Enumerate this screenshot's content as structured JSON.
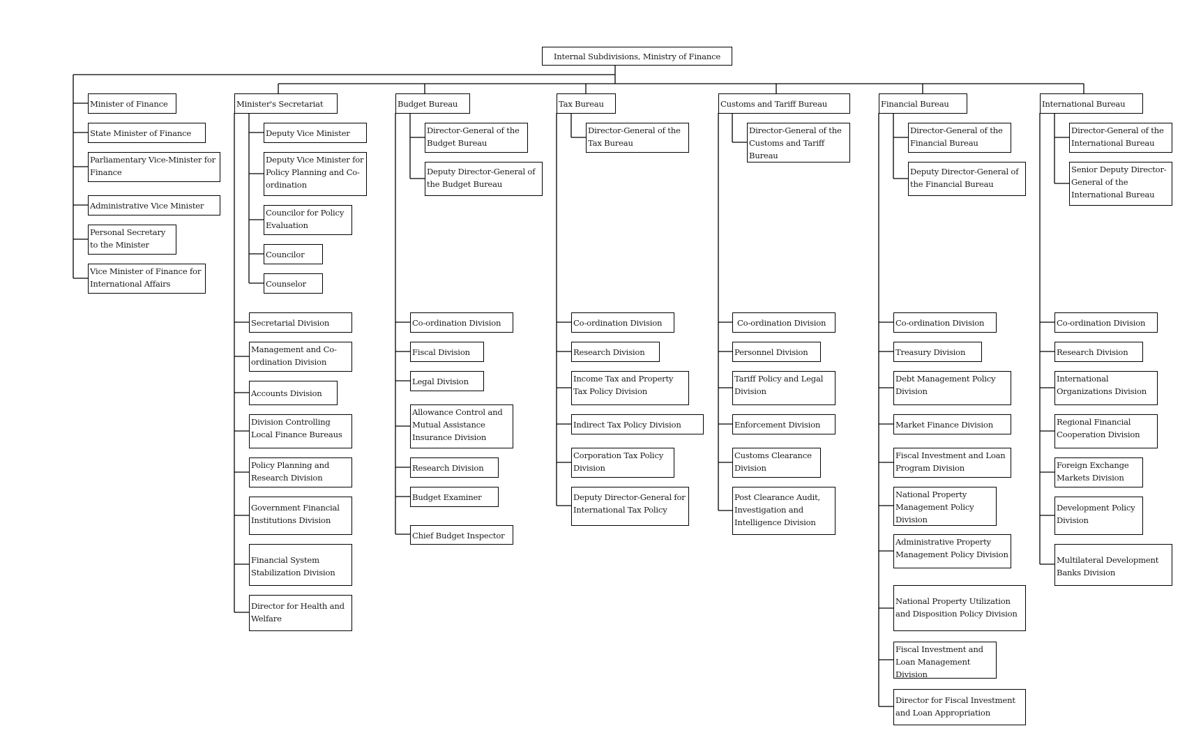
{
  "root": {
    "label": "Internal Subdivisions, Ministry of Finance"
  },
  "ministers": [
    "Minister of Finance",
    "State Minister of Finance",
    "Parliamentary Vice-Minister for Finance",
    "Administrative Vice Minister",
    "Personal Secretary to the Minister",
    "Vice Minister of Finance for International Affairs"
  ],
  "bureaus": [
    {
      "name": "Minister's Secretariat",
      "officials": [
        "Deputy Vice Minister",
        "Deputy Vice Minister for Policy Planning and  Co-ordination",
        "Councilor for Policy Evaluation",
        "Councilor",
        "Counselor"
      ],
      "divisions": [
        "Secretarial Division",
        "Management and Co-ordination Division",
        "Accounts Division",
        "Division Controlling Local Finance Bureaus",
        "Policy Planning and Research Division",
        "Government Financial Institutions Division",
        "Financial System Stabilization Division",
        "Director for Health and Welfare"
      ]
    },
    {
      "name": "Budget Bureau",
      "officials": [
        "Director-General of the Budget Bureau",
        "Deputy Director-General of the Budget Bureau"
      ],
      "divisions": [
        "Co-ordination Division",
        "Fiscal Division",
        "Legal Division",
        "Allowance Control and Mutual Assistance Insurance Division",
        "Research Division",
        "Budget Examiner",
        "Chief Budget Inspector"
      ]
    },
    {
      "name": "Tax Bureau",
      "officials": [
        "Director-General of the Tax Bureau"
      ],
      "divisions": [
        "Co-ordination Division",
        "Research Division",
        "Income Tax and Property Tax Policy Division",
        "Indirect Tax Policy Division",
        "Corporation Tax Policy Division",
        "Deputy Director-General for International Tax Policy"
      ]
    },
    {
      "name": "Customs and Tariff Bureau",
      "officials": [
        "Director-General of the Customs and Tariff Bureau"
      ],
      "divisions": [
        "Co-ordination Division",
        "Personnel Division",
        "Tariff Policy and Legal Division",
        "Enforcement Division",
        "Customs Clearance Division",
        "Post Clearance Audit, Investigation and Intelligence Division"
      ]
    },
    {
      "name": "Financial Bureau",
      "officials": [
        "Director-General of the Financial Bureau",
        "Deputy Director-General of the Financial Bureau"
      ],
      "divisions": [
        "Co-ordination Division",
        "Treasury Division",
        "Debt Management Policy Division",
        "Market Finance Division",
        "Fiscal Investment and Loan Program Division",
        "National Property Management Policy Division",
        "Administrative Property Management Policy Division",
        "National Property Utilization and Disposition Policy Division",
        "Fiscal Investment and Loan Management Division",
        "Director for Fiscal Investment and Loan Appropriation"
      ]
    },
    {
      "name": "International Bureau",
      "officials": [
        "Director-General of the International Bureau",
        "Senior Deputy Director-General of the International Bureau"
      ],
      "divisions": [
        "Co-ordination Division",
        "Research Division",
        "International Organizations Division",
        "Regional Financial Cooperation Division",
        "Foreign Exchange Markets Division",
        "Development Policy Division",
        "Multilateral Development Banks Division"
      ]
    }
  ]
}
